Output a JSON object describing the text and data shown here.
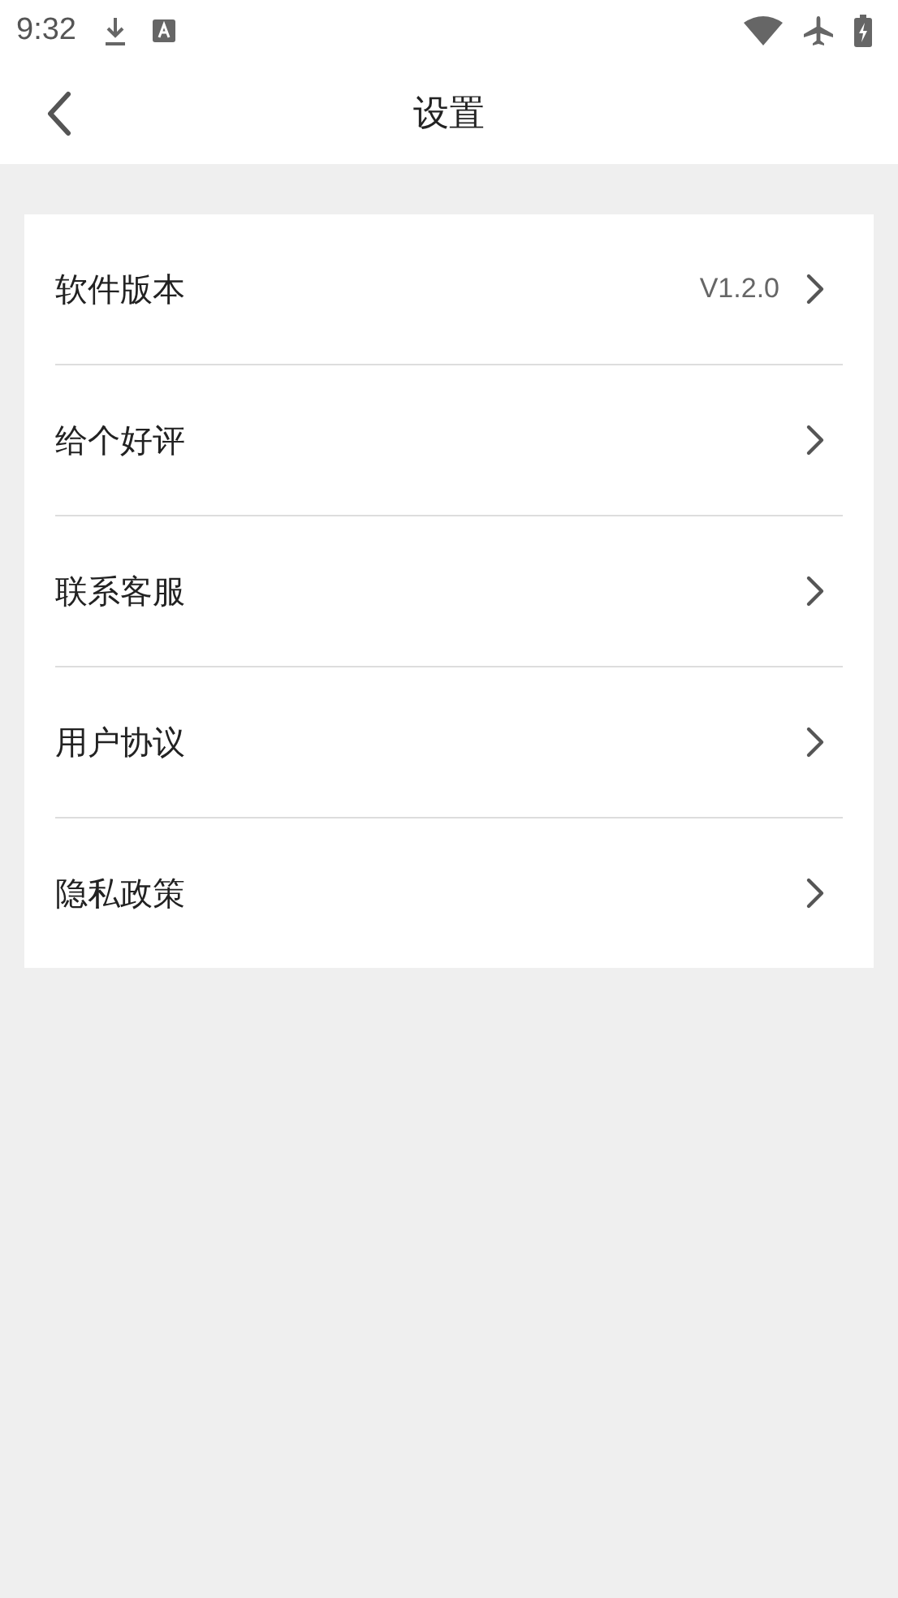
{
  "status_bar": {
    "time": "9:32"
  },
  "header": {
    "title": "设置"
  },
  "items": [
    {
      "label": "软件版本",
      "value": "V1.2.0"
    },
    {
      "label": "给个好评"
    },
    {
      "label": "联系客服"
    },
    {
      "label": "用户协议"
    },
    {
      "label": "隐私政策"
    }
  ]
}
